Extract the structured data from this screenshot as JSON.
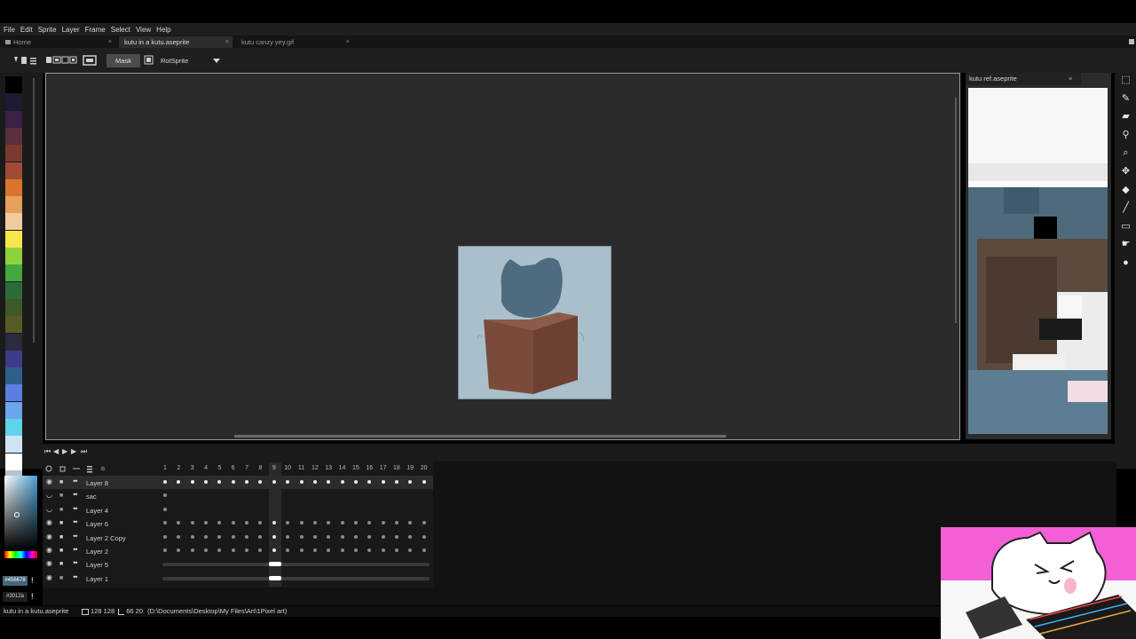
{
  "menu": [
    "File",
    "Edit",
    "Sprite",
    "Layer",
    "Frame",
    "Select",
    "View",
    "Help"
  ],
  "tabs": {
    "home": "Home",
    "active": "kutu in a kutu.aseprite",
    "other": "kutu canzy yey.gif",
    "close_glyph": "×"
  },
  "toolbar": {
    "mask_label": "Mask",
    "rotation_algorithm": "RotSprite"
  },
  "palette": [
    "#000000",
    "#1d1a33",
    "#3a2146",
    "#5c2f3c",
    "#7a3a32",
    "#a14a37",
    "#d9742b",
    "#e8a05c",
    "#f3c9a0",
    "#f4e74a",
    "#8fd13c",
    "#42a83f",
    "#2b6c3a",
    "#3c5a2a",
    "#5a5a26",
    "#2a2a40",
    "#3c3c88",
    "#2e5f8a",
    "#5b7ee0",
    "#6aa5f0",
    "#5fd3e8",
    "#cfe3f5",
    "#ffffff",
    "#b8c3cb"
  ],
  "preview": {
    "title": "kutu ref.aseprite",
    "close_glyph": "×"
  },
  "tools": [
    "marquee-icon",
    "pencil-icon",
    "eraser-icon",
    "eyedropper-icon",
    "zoom-icon",
    "move-icon",
    "paint-bucket-icon",
    "line-icon",
    "rectangle-icon",
    "smudge-icon",
    "blur-icon"
  ],
  "timeline": {
    "frames": [
      "1",
      "2",
      "3",
      "4",
      "5",
      "6",
      "7",
      "8",
      "9",
      "10",
      "11",
      "12",
      "13",
      "14",
      "15",
      "16",
      "17",
      "18",
      "19",
      "20"
    ],
    "current_frame": 9,
    "layers": [
      {
        "name": "Layer 8",
        "visible": true,
        "locked": true,
        "selected": true,
        "cels": [
          1,
          2,
          3,
          4,
          5,
          6,
          7,
          8,
          9,
          10,
          11,
          12,
          13,
          14,
          15,
          16,
          17,
          18,
          19,
          20
        ],
        "track": false
      },
      {
        "name": "sac",
        "visible": false,
        "locked": false,
        "selected": false,
        "cels": [
          1
        ],
        "track": false
      },
      {
        "name": "Layer 4",
        "visible": false,
        "locked": false,
        "selected": false,
        "cels": [
          1
        ],
        "track": false
      },
      {
        "name": "Layer 6",
        "visible": true,
        "locked": true,
        "selected": false,
        "cels": [
          1,
          2,
          3,
          4,
          5,
          6,
          7,
          8,
          9,
          10,
          11,
          12,
          13,
          14,
          15,
          16,
          17,
          18,
          19,
          20
        ],
        "track": false
      },
      {
        "name": "Layer 2 Copy",
        "visible": true,
        "locked": true,
        "selected": false,
        "cels": [
          1,
          2,
          3,
          4,
          5,
          6,
          7,
          8,
          9,
          10,
          11,
          12,
          13,
          14,
          15,
          16,
          17,
          18,
          19,
          20
        ],
        "track": false
      },
      {
        "name": "Layer 2",
        "visible": true,
        "locked": true,
        "selected": false,
        "cels": [
          1,
          2,
          3,
          4,
          5,
          6,
          7,
          8,
          9,
          10,
          11,
          12,
          13,
          14,
          15,
          16,
          17,
          18,
          19,
          20
        ],
        "track": false
      },
      {
        "name": "Layer 5",
        "visible": true,
        "locked": true,
        "selected": false,
        "cels": [],
        "track": true
      },
      {
        "name": "Layer 1",
        "visible": true,
        "locked": false,
        "selected": false,
        "cels": [],
        "track": true
      }
    ]
  },
  "colors": {
    "foreground": "#456678",
    "background": "#3012a"
  },
  "status": {
    "filename": "kutu in a kutu.aseprite",
    "size": "128 128",
    "position": "66 20",
    "path": "(D:\\Documents\\Desktop\\My Files\\Art\\1Pixel art)"
  }
}
